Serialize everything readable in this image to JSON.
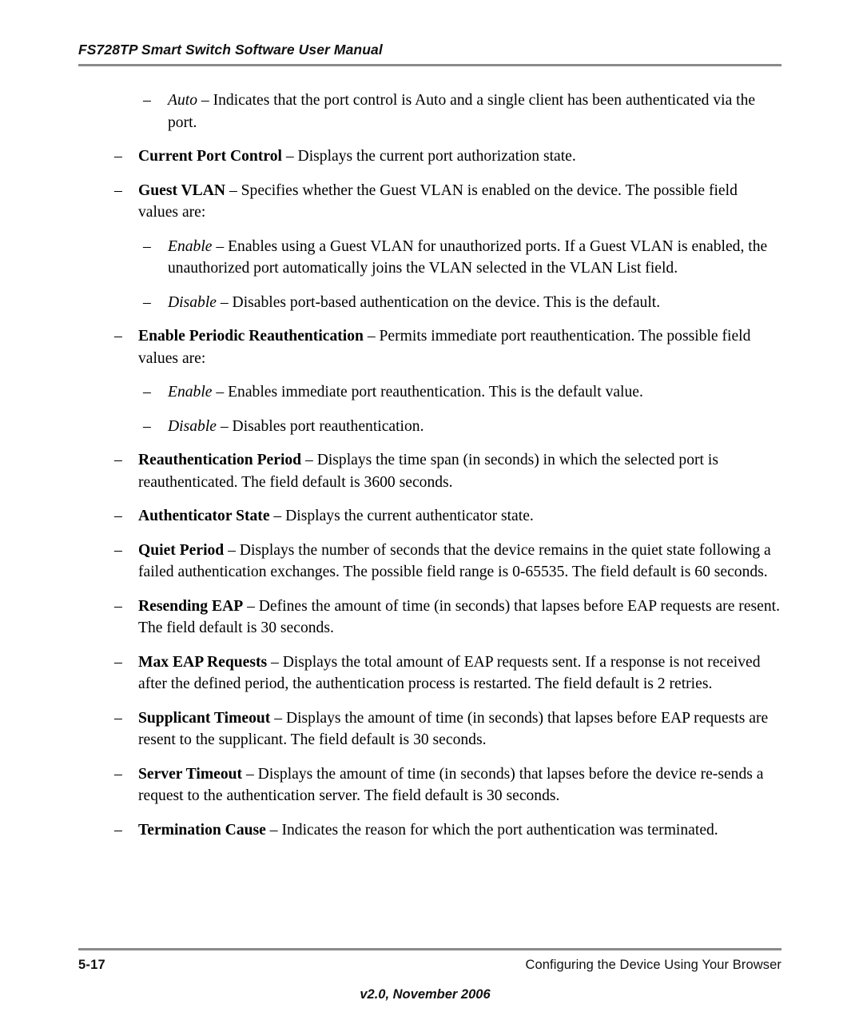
{
  "header": {
    "title": "FS728TP Smart Switch Software User Manual"
  },
  "content": {
    "items": [
      {
        "level": 2,
        "dash": "–",
        "term": "Auto",
        "term_style": "italic",
        "separator": " – ",
        "text": "Indicates that the port control is Auto and a single client has been authenticated via the port."
      },
      {
        "level": 1,
        "dash": "–",
        "term": "Current Port Control",
        "term_style": "bold",
        "separator": " – ",
        "text": "Displays the current port authorization state."
      },
      {
        "level": 1,
        "dash": "–",
        "term": "Guest VLAN",
        "term_style": "bold",
        "separator": " – ",
        "text": "Specifies whether the Guest VLAN is enabled on the device. The possible field values are:"
      },
      {
        "level": 2,
        "dash": "–",
        "term": "Enable",
        "term_style": "italic",
        "separator": " – ",
        "text": "Enables using a Guest VLAN for unauthorized ports. If a Guest VLAN is enabled, the unauthorized port automatically joins the VLAN selected in the VLAN List field."
      },
      {
        "level": 2,
        "dash": "–",
        "term": "Disable",
        "term_style": "italic",
        "separator": " – ",
        "text": "Disables port-based authentication on the device. This is the default."
      },
      {
        "level": 1,
        "dash": "–",
        "term": "Enable Periodic Reauthentication",
        "term_style": "bold",
        "separator": " – ",
        "text": "Permits immediate port reauthentication. The possible field values are:"
      },
      {
        "level": 2,
        "dash": "–",
        "term": "Enable",
        "term_style": "italic",
        "separator": " – ",
        "text": "Enables immediate port reauthentication. This is the default value."
      },
      {
        "level": 2,
        "dash": "–",
        "term": "Disable",
        "term_style": "italic",
        "separator": " – ",
        "text": "Disables port reauthentication."
      },
      {
        "level": 1,
        "dash": "–",
        "term": "Reauthentication Period",
        "term_style": "bold",
        "separator": " – ",
        "text": "Displays the time span (in seconds) in which the selected port is reauthenticated. The field default is 3600 seconds."
      },
      {
        "level": 1,
        "dash": "–",
        "term": "Authenticator State",
        "term_style": "bold",
        "separator": " – ",
        "text": "Displays the current authenticator state."
      },
      {
        "level": 1,
        "dash": "–",
        "term": "Quiet Period",
        "term_style": "bold",
        "separator": " – ",
        "text": "Displays the number of seconds that the device remains in the quiet state following a failed authentication exchanges. The possible field range is 0-65535. The field default is 60 seconds."
      },
      {
        "level": 1,
        "dash": "–",
        "term": "Resending EAP",
        "term_style": "bold",
        "separator": " – ",
        "text": "Defines the amount of time (in seconds) that lapses before EAP requests are resent. The field default is 30 seconds."
      },
      {
        "level": 1,
        "dash": "–",
        "term": "Max EAP Requests",
        "term_style": "bold",
        "separator": " – ",
        "text": "Displays the total amount of EAP requests sent. If a response is not received after the defined period, the authentication process is restarted. The field default is 2 retries."
      },
      {
        "level": 1,
        "dash": "–",
        "term": "Supplicant Timeout",
        "term_style": "bold",
        "separator": " – ",
        "text": "Displays the amount of time (in seconds) that lapses before EAP requests are resent to the supplicant. The field default is 30 seconds."
      },
      {
        "level": 1,
        "dash": "–",
        "term": "Server Timeout",
        "term_style": "bold",
        "separator": " – ",
        "text": "Displays the amount of time (in seconds) that lapses before the device re-sends a request to the authentication server. The field default is 30 seconds."
      },
      {
        "level": 1,
        "dash": "–",
        "term": "Termination Cause",
        "term_style": "bold",
        "separator": " – ",
        "text": "Indicates the reason for which the port authentication was terminated."
      }
    ]
  },
  "footer": {
    "page_number": "5-17",
    "section": "Configuring the Device Using Your Browser",
    "version": "v2.0, November 2006"
  }
}
